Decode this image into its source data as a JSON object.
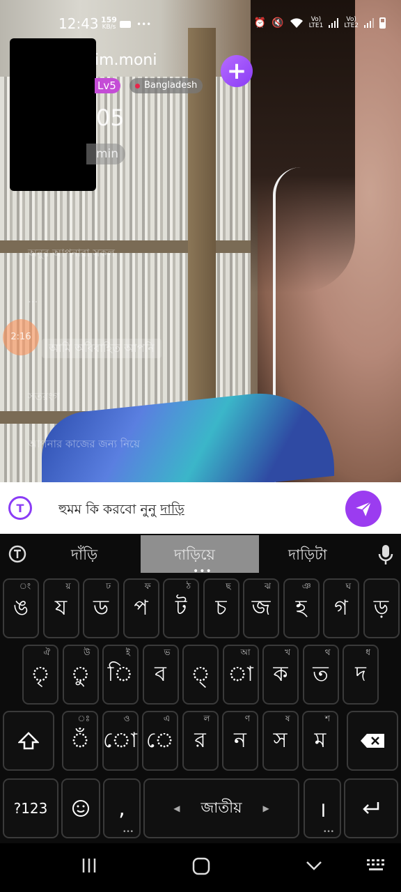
{
  "status_bar": {
    "time": "12:43",
    "speed_value": "159",
    "speed_unit": "KB/s",
    "lte1_top": "Vo)",
    "lte1_bottom": "LTE1",
    "lte2_top": "Vo)",
    "lte2_bottom": "LTE2"
  },
  "host": {
    "name": "im.moni",
    "level": "Lv5",
    "country": "Bangladesh",
    "viewer_count": "05",
    "duration": "min"
  },
  "chat": {
    "line1": "অনুর আপনারা সকল",
    "line2": "...",
    "timer": "2:16",
    "bubble": "আমি অবিবাহিত আপনি",
    "line3": "সতরংগ",
    "line4": "আপনার কাজের জন্য নিয়ে"
  },
  "input": {
    "text_plain": "হুমম কি করবো নুনু ",
    "text_underlined": "দাড়ি"
  },
  "keyboard": {
    "suggestions": [
      "দাঁড়ি",
      "দাড়িয়ে",
      "দাড়িটা"
    ],
    "row1": [
      {
        "label": "ঙ",
        "hint": "ং"
      },
      {
        "label": "য",
        "hint": "য়"
      },
      {
        "label": "ড",
        "hint": "ঢ"
      },
      {
        "label": "প",
        "hint": "ফ"
      },
      {
        "label": "ট",
        "hint": "ঠ"
      },
      {
        "label": "চ",
        "hint": "ছ"
      },
      {
        "label": "জ",
        "hint": "ঝ"
      },
      {
        "label": "হ",
        "hint": "ঞ"
      },
      {
        "label": "গ",
        "hint": "ঘ"
      },
      {
        "label": "ড়",
        "hint": ""
      }
    ],
    "row2": [
      {
        "label": "ৃ",
        "hint": "ঐ"
      },
      {
        "label": "ু",
        "hint": "উ"
      },
      {
        "label": "ি",
        "hint": "ই"
      },
      {
        "label": "ব",
        "hint": "ভ"
      },
      {
        "label": "্",
        "hint": ""
      },
      {
        "label": "া",
        "hint": "আ"
      },
      {
        "label": "ক",
        "hint": "খ"
      },
      {
        "label": "ত",
        "hint": "থ"
      },
      {
        "label": "দ",
        "hint": "ধ"
      }
    ],
    "row3": [
      {
        "label": "ঁ",
        "hint": "ঃ"
      },
      {
        "label": "ো",
        "hint": "ও"
      },
      {
        "label": "ে",
        "hint": "এ"
      },
      {
        "label": "র",
        "hint": "ল"
      },
      {
        "label": "ন",
        "hint": "ণ"
      },
      {
        "label": "স",
        "hint": "ষ"
      },
      {
        "label": "ম",
        "hint": "শ"
      }
    ],
    "numbers_label": "?123",
    "space_label": "জাতীয়",
    "comma_label": ",",
    "period_label": "।"
  }
}
